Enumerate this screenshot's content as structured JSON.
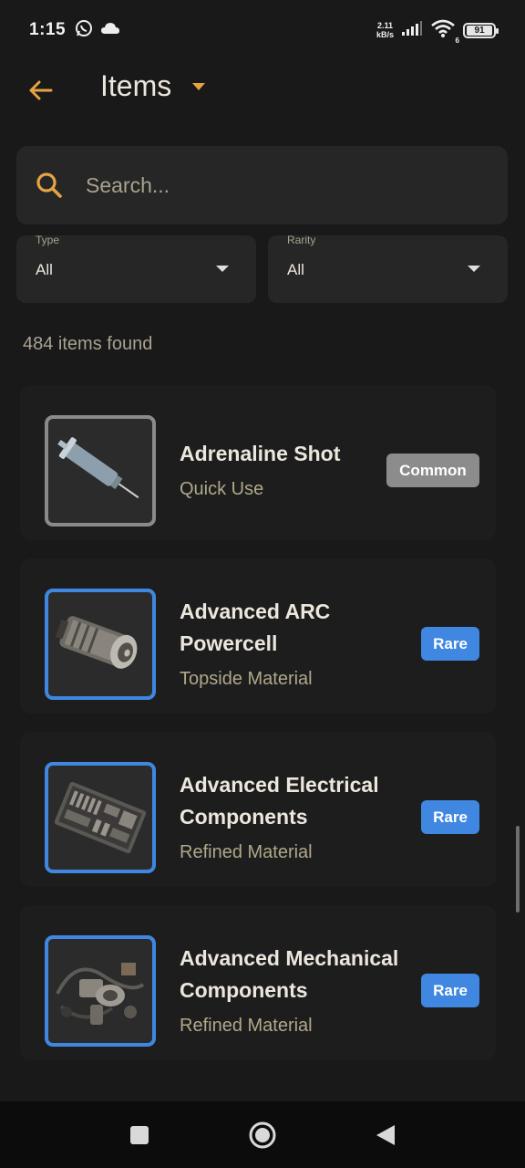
{
  "status_bar": {
    "time": "1:15",
    "net_speed_value": "2.11",
    "net_speed_unit": "kB/s",
    "wifi_badge": "6",
    "battery": "91"
  },
  "header": {
    "title": "Items"
  },
  "search": {
    "placeholder": "Search..."
  },
  "filters": {
    "type": {
      "label": "Type",
      "value": "All"
    },
    "rarity": {
      "label": "Rarity",
      "value": "All"
    }
  },
  "results": {
    "count_text": "484 items found"
  },
  "items": [
    {
      "name": "Adrenaline Shot",
      "category": "Quick Use",
      "rarity": "Common",
      "icon": "syringe-icon"
    },
    {
      "name": "Advanced ARC Powercell",
      "category": "Topside Material",
      "rarity": "Rare",
      "icon": "powercell-icon"
    },
    {
      "name": "Advanced Electrical Components",
      "category": "Refined Material",
      "rarity": "Rare",
      "icon": "electrical-components-icon"
    },
    {
      "name": "Advanced Mechanical Components",
      "category": "Refined Material",
      "rarity": "Rare",
      "icon": "mechanical-components-icon"
    }
  ],
  "colors": {
    "accent": "#e5a443",
    "rare": "#3f87e0",
    "common": "#8c8c8c",
    "background": "#191919"
  }
}
